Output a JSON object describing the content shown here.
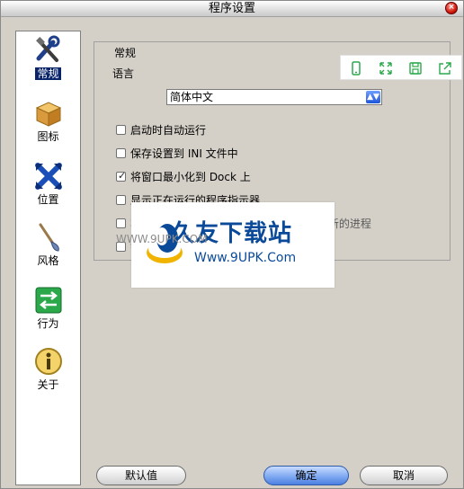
{
  "window": {
    "title": "程序设置"
  },
  "sidebar": {
    "items": [
      {
        "label": "常规",
        "icon": "tools-icon",
        "active": true
      },
      {
        "label": "图标",
        "icon": "box-icon",
        "active": false
      },
      {
        "label": "位置",
        "icon": "arrows-icon",
        "active": false
      },
      {
        "label": "风格",
        "icon": "brush-icon",
        "active": false
      },
      {
        "label": "行为",
        "icon": "switch-arrows-icon",
        "active": false
      },
      {
        "label": "关于",
        "icon": "info-icon",
        "active": false
      }
    ]
  },
  "general": {
    "group_title": "常规",
    "language_label": "语言",
    "language_value": "简体中文",
    "options": [
      {
        "label": "启动时自动运行",
        "checked": false
      },
      {
        "label": "保存设置到 INI 文件中",
        "checked": false
      },
      {
        "label": "将窗口最小化到 Dock 上",
        "checked": true
      },
      {
        "label": "显示正在运行的程序指示器",
        "checked": false
      },
      {
        "label": "将已经在运行的程序在桌面显示,而不开启新的进程",
        "checked": false
      },
      {
        "label": "锁",
        "checked": false
      }
    ]
  },
  "watermark": {
    "title": "久友下载站",
    "url": "Www.9UPK.Com",
    "ghost_text": "WWW.9UPK.COM"
  },
  "overlay_toolbar": {
    "icons": [
      "phone-icon",
      "fullscreen-icon",
      "save-icon",
      "share-icon"
    ]
  },
  "buttons": {
    "defaults": "默认值",
    "ok": "确定",
    "cancel": "取消"
  }
}
